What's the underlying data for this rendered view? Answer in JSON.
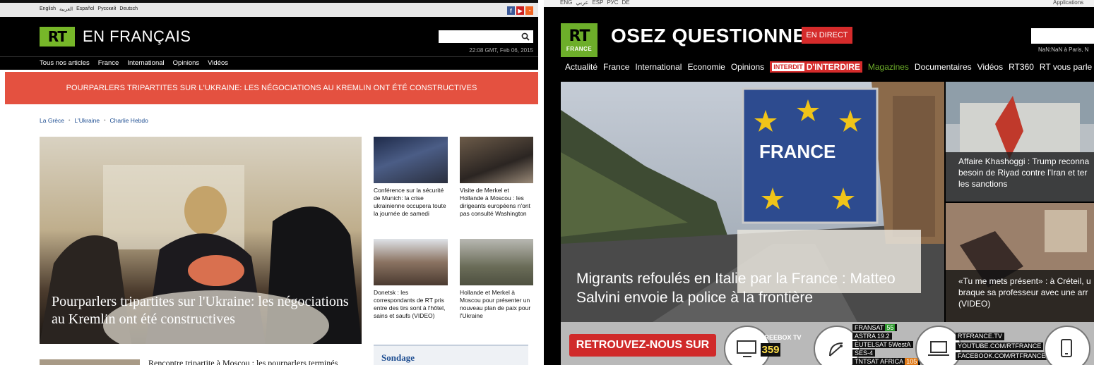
{
  "left": {
    "languages": [
      "English",
      "العربية",
      "Español",
      "Русский",
      "Deutsch"
    ],
    "logo": "RT",
    "brand": "EN FRANÇAIS",
    "time": "22:08 GMT, Feb 06, 2015",
    "nav": [
      "Tous nos articles",
      "France",
      "International",
      "Opinions",
      "Vidéos"
    ],
    "banner": "POURPARLERS TRIPARTITES SUR L'UKRAINE: LES NÉGOCIATIONS AU KREMLIN ONT ÉTÉ CONSTRUCTIVES",
    "tags": [
      "La Grèce",
      "L'Ukraine",
      "Charlie Hebdo"
    ],
    "hero_title": "Pourparlers tripartites sur l'Ukraine: les négociations au Kremlin ont été constructives",
    "thumbs": [
      {
        "caption": "Conférence sur la sécurité de Munich: la crise ukrainienne occupera toute la journée de samedi"
      },
      {
        "caption": "Visite de Merkel et Hollande à Moscou : les dirigeants européens n'ont pas consulté Washington"
      },
      {
        "caption": "Donetsk : les correspondants de RT pris entre des tirs sont à l'hôtel, sains et saufs (VIDEO)"
      },
      {
        "caption": "Hollande et Merkel à Moscou pour présenter un nouveau plan de paix pour l'Ukraine"
      }
    ],
    "poll_title": "Sondage",
    "bottom_article": "Rencontre tripartite à Moscou : les pourparlers terminés"
  },
  "right": {
    "languages": [
      "ENG",
      "عربي",
      "ESP",
      "РУС",
      "DE"
    ],
    "apps": "Applications",
    "logo_rt": "RT",
    "logo_sub": "FRANCE",
    "brand": "OSEZ QUESTIONNER",
    "live_button": "EN DIRECT",
    "time": "NaN:NaN à Paris, N",
    "nav": [
      "Actualité",
      "France",
      "International",
      "Economie",
      "Opinions"
    ],
    "interdit_box": "INTERDIT",
    "interdit_label": "D'INTERDIRE",
    "magazines": "Magazines",
    "nav_after": [
      "Documentaires",
      "Vidéos",
      "RT360",
      "RT vous parle"
    ],
    "hero_title": "Migrants refoulés en Italie par la France : Matteo Salvini envoie la police à la frontière",
    "hero_sign": "FRANCE",
    "side": [
      {
        "title": "Affaire Khashoggi : Trump reconna besoin de Riyad contre l'Iran et ter les sanctions"
      },
      {
        "title": "«Tu me mets présent» : à Créteil, u braque sa professeur avec une arr (VIDEO)"
      }
    ],
    "strip": {
      "button": "RETROUVEZ-NOUS SUR",
      "freebox_label": "FREEBOX TV",
      "freebox_num": "359",
      "channels": [
        {
          "name": "FRANSAT",
          "num": "55"
        },
        {
          "name": "ASTRA 19.2",
          "num": ""
        },
        {
          "name": "EUTELSAT 5WestA",
          "num": ""
        },
        {
          "name": "SES-4",
          "num": ""
        },
        {
          "name": "TNTSAT AFRICA",
          "num": "105"
        }
      ],
      "web": [
        "RTFRANCE.TV",
        "YOUTUBE.COM/RTFRANCE",
        "FACEBOOK.COM/RTFRANCE"
      ]
    }
  },
  "colors": {
    "rt_green_2015": "#77b729",
    "rt_green_2018": "#6dae2a",
    "banner_red": "#e45140",
    "live_red": "#d52b2b",
    "link_blue": "#1d4d91"
  }
}
